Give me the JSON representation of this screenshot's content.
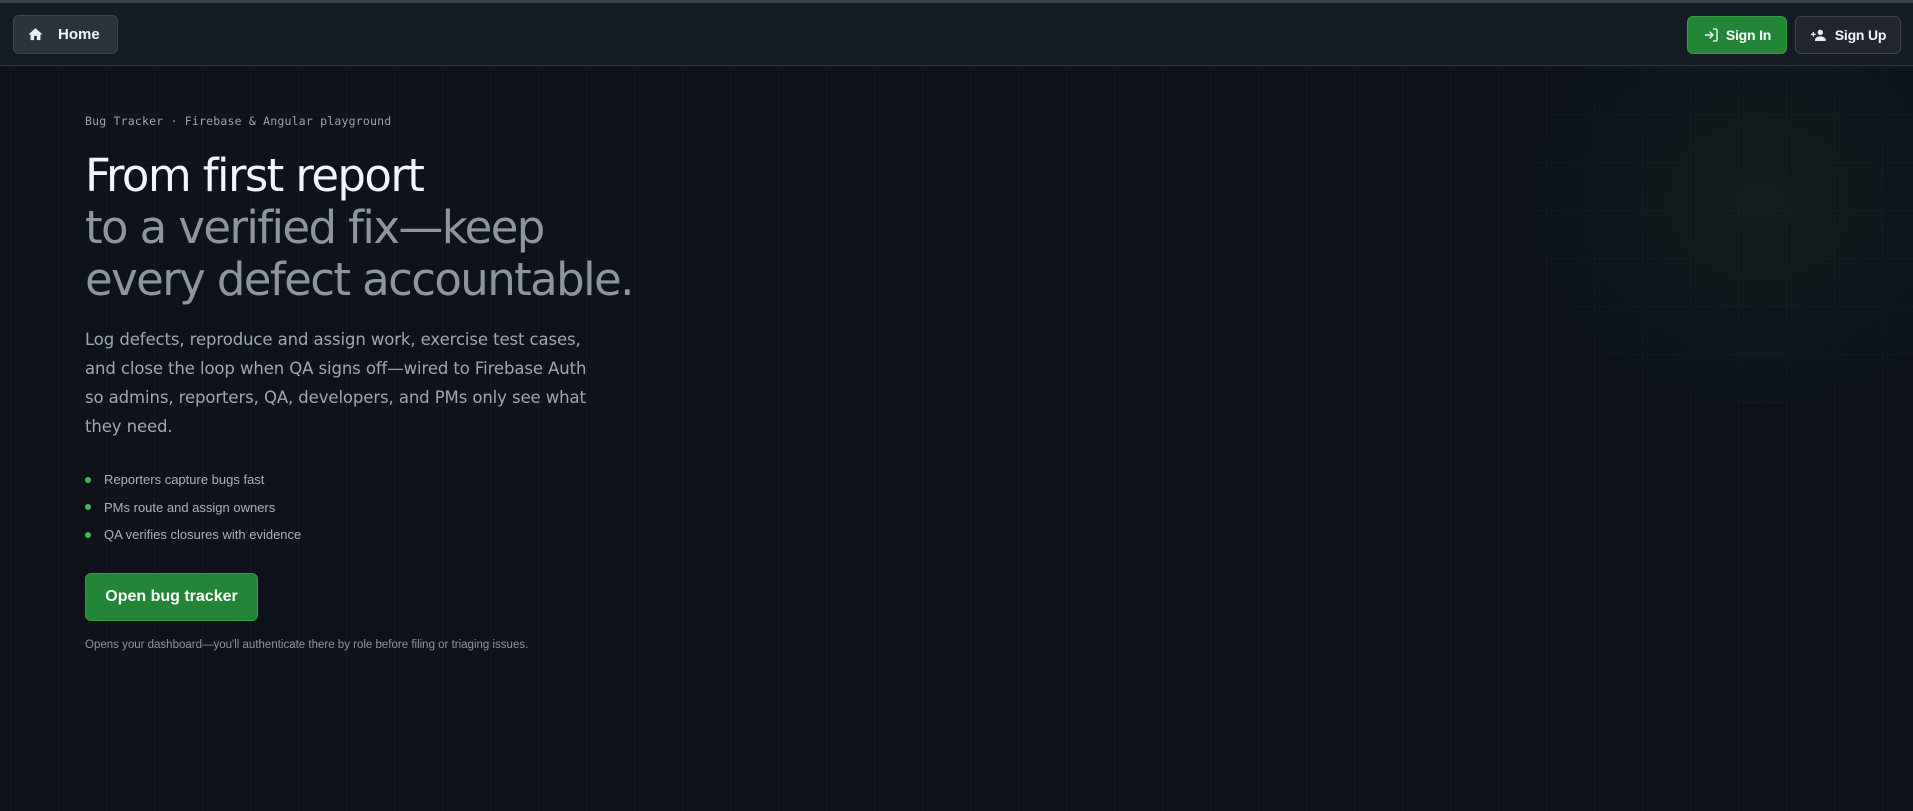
{
  "nav": {
    "home_label": "Home",
    "signin_label": "Sign In",
    "signup_label": "Sign Up",
    "home_icon": "home-icon",
    "signin_icon": "sign-in-icon",
    "signup_icon": "person-add-icon"
  },
  "hero": {
    "eyebrow": "Bug Tracker · Firebase & Angular playground",
    "headline_line1": "From first report",
    "headline_line2": "to a verified fix—keep every defect accountable.",
    "lead": "Log defects, reproduce and assign work, exercise test cases, and close the loop when QA signs off—wired to Firebase Auth so admins, reporters, QA, developers, and PMs only see what they need.",
    "features": [
      "Reporters capture bugs fast",
      "PMs route and assign owners",
      "QA verifies closures with evidence"
    ],
    "cta_label": "Open bug tracker",
    "footnote": "Opens your dashboard—you'll authenticate there by role before filing or triaging issues."
  },
  "colors": {
    "background": "#0e131b",
    "navbar": "#151b23",
    "accent_green": "#238636",
    "bullet_green": "#3fb950"
  }
}
